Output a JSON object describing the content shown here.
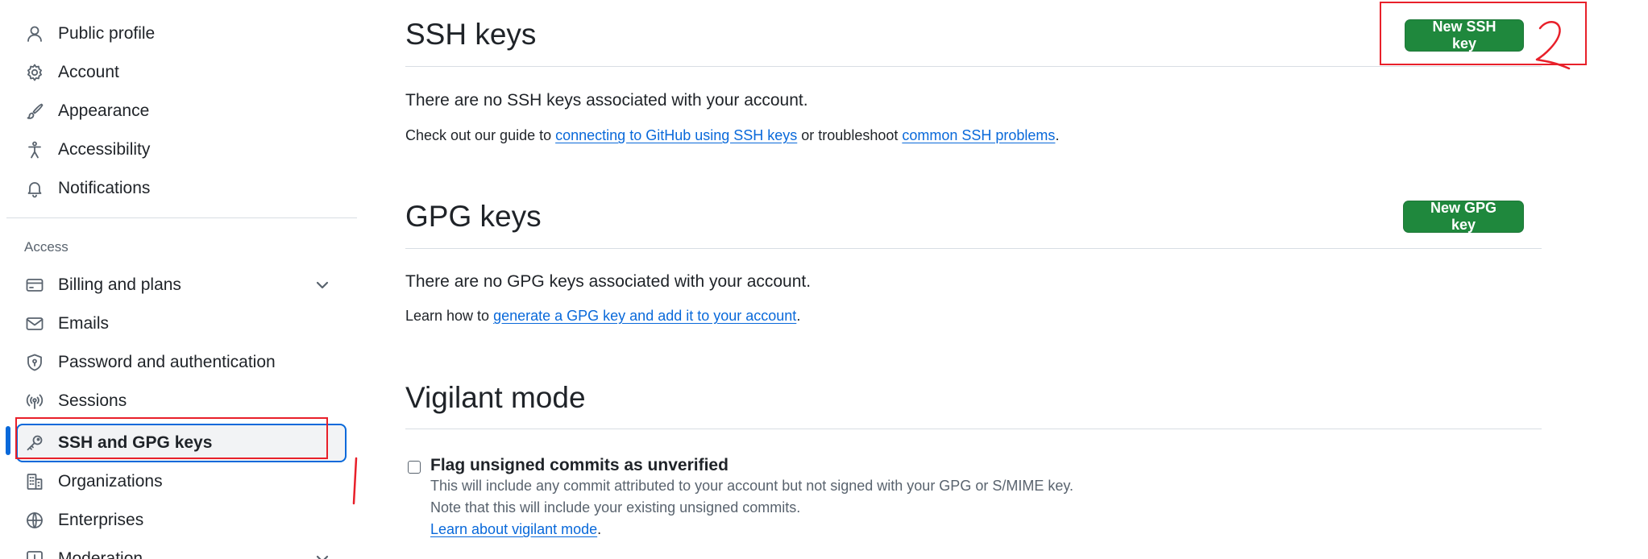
{
  "sidebar": {
    "items": [
      {
        "label": "Public profile",
        "icon": "person-icon"
      },
      {
        "label": "Account",
        "icon": "gear-icon"
      },
      {
        "label": "Appearance",
        "icon": "paintbrush-icon"
      },
      {
        "label": "Accessibility",
        "icon": "accessibility-icon"
      },
      {
        "label": "Notifications",
        "icon": "bell-icon"
      }
    ],
    "access_heading": "Access",
    "access_items": [
      {
        "label": "Billing and plans",
        "icon": "credit-card-icon",
        "expandable": true
      },
      {
        "label": "Emails",
        "icon": "mail-icon"
      },
      {
        "label": "Password and authentication",
        "icon": "shield-lock-icon"
      },
      {
        "label": "Sessions",
        "icon": "broadcast-icon"
      },
      {
        "label": "SSH and GPG keys",
        "icon": "key-icon",
        "active": true
      },
      {
        "label": "Organizations",
        "icon": "organization-icon"
      },
      {
        "label": "Enterprises",
        "icon": "globe-icon"
      },
      {
        "label": "Moderation",
        "icon": "report-icon",
        "expandable": true
      }
    ]
  },
  "ssh": {
    "title": "SSH keys",
    "new_button": "New SSH key",
    "empty_text": "There are no SSH keys associated with your account.",
    "guide_prefix": "Check out our guide to ",
    "guide_link": "connecting to GitHub using SSH keys",
    "guide_middle": " or troubleshoot ",
    "problems_link": "common SSH problems",
    "guide_suffix": "."
  },
  "gpg": {
    "title": "GPG keys",
    "new_button": "New GPG key",
    "empty_text": "There are no GPG keys associated with your account.",
    "learn_prefix": "Learn how to ",
    "learn_link": "generate a GPG key and add it to your account",
    "learn_suffix": "."
  },
  "vigilant": {
    "title": "Vigilant mode",
    "checkbox_label": "Flag unsigned commits as unverified",
    "checked": false,
    "desc_line1": "This will include any commit attributed to your account but not signed with your GPG or S/MIME key.",
    "desc_line2": "Note that this will include your existing unsigned commits.",
    "learn_link": "Learn about vigilant mode",
    "learn_suffix": "."
  },
  "colors": {
    "primary_button": "#1f883d",
    "link": "#0969da",
    "annotation": "#e8202a"
  }
}
